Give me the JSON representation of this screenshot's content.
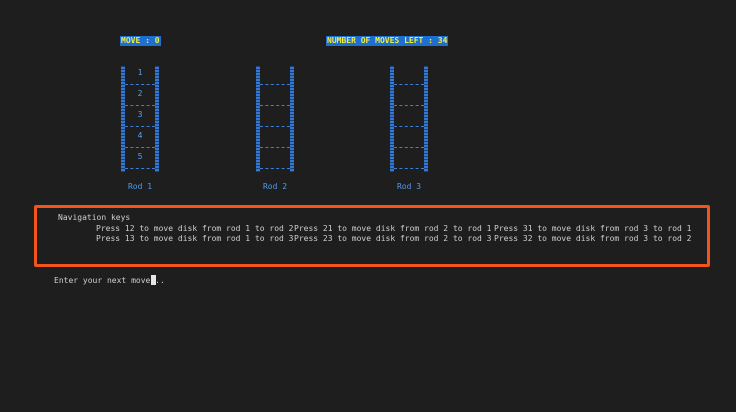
{
  "header": {
    "moves_label": "MOVE : 0",
    "moves_left_label": "NUMBER OF MOVES LEFT : 34"
  },
  "rods": [
    {
      "label": "Rod 1",
      "disks": [
        "1",
        "2",
        "3",
        "4",
        "5"
      ]
    },
    {
      "label": "Rod 2",
      "disks": []
    },
    {
      "label": "Rod 3",
      "disks": []
    }
  ],
  "navigation": {
    "title": "Navigation keys",
    "keys": [
      "Press 12 to move disk from rod 1 to rod 2",
      "Press 13 to move disk from rod 1 to rod 3",
      "Press 21 to move disk from rod 2 to rod 1",
      "Press 23 to move disk from rod 2 to rod 3",
      "Press 31 to move disk from rod 3 to rod 1",
      "Press 32 to move disk from rod 3 to rod 2"
    ]
  },
  "prompt": {
    "text": "Enter your next move..."
  },
  "colors": {
    "background": "#1e1e1e",
    "highlight_bg": "#1f6fd1",
    "highlight_text": "#f2ee3a",
    "rod_blue": "#3478d4",
    "box_orange": "#f2541b"
  }
}
